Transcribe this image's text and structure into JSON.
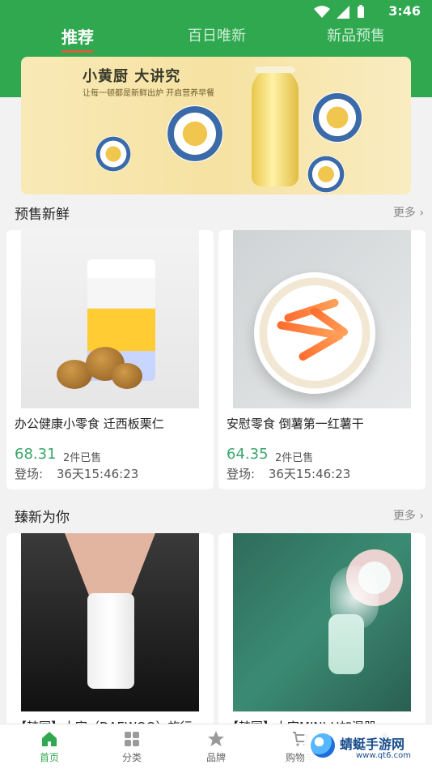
{
  "status_bar": {
    "time": "3:46"
  },
  "top_tabs": [
    {
      "label": "推荐"
    },
    {
      "label": "百日唯新"
    },
    {
      "label": "新品预售"
    }
  ],
  "banner": {
    "title": "小黄厨 大讲究",
    "subtitle": "让每一顿都是新鲜出炉 开启营养早餐"
  },
  "sections": {
    "presale": {
      "title": "预售新鲜",
      "more": "更多"
    },
    "new_for_you": {
      "title": "臻新为你",
      "more": "更多"
    }
  },
  "presale_products": [
    {
      "name": "办公健康小零食 迁西板栗仁",
      "price": "68.31",
      "sold": "2件已售",
      "debut_label": "登场:",
      "debut_time": "36天15:46:23"
    },
    {
      "name": "安慰零食 倒薯第一红薯干",
      "price": "64.35",
      "sold": "2件已售",
      "debut_label": "登场:",
      "debut_time": "36天15:46:23"
    }
  ],
  "new_products_partial": [
    {
      "name_partial": "【韩国】大宇（DAEWOO）旅行"
    },
    {
      "name_partial": "【韩国】大宇MINI-H加湿器"
    }
  ],
  "bottom_nav": [
    {
      "label": "首页",
      "icon": "home-icon"
    },
    {
      "label": "分类",
      "icon": "grid-icon"
    },
    {
      "label": "品牌",
      "icon": "star-icon"
    },
    {
      "label": "购物车",
      "icon": "cart-icon"
    },
    {
      "label": "",
      "icon": "user-icon"
    }
  ],
  "watermark": {
    "brand": "蜻蜓手游网",
    "domain": "www.qt6.com"
  },
  "colors": {
    "primary_green": "#2fa84f",
    "price_green": "#3aa66a",
    "tab_underline": "#d95c3d"
  }
}
